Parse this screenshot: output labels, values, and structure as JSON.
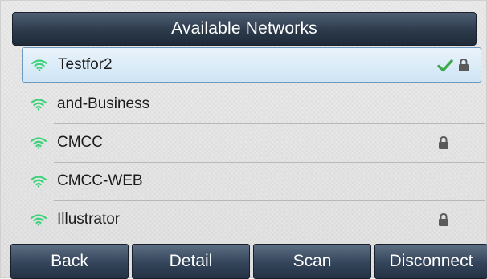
{
  "header": {
    "title": "Available Networks"
  },
  "networks": [
    {
      "name": "Testfor2",
      "connected": true,
      "secured": true,
      "selected": true
    },
    {
      "name": "and-Business",
      "connected": false,
      "secured": false,
      "selected": false
    },
    {
      "name": "CMCC",
      "connected": false,
      "secured": true,
      "selected": false
    },
    {
      "name": "CMCC-WEB",
      "connected": false,
      "secured": false,
      "selected": false
    },
    {
      "name": "Illustrator",
      "connected": false,
      "secured": true,
      "selected": false
    }
  ],
  "softkeys": [
    {
      "label": "Back"
    },
    {
      "label": "Detail"
    },
    {
      "label": "Scan"
    },
    {
      "label": "Disconnect"
    }
  ],
  "colors": {
    "wifi_green": "#3fd27a",
    "check_green": "#3ca94a",
    "lock_gray": "#5a5a5a",
    "title_bar": "#2c3a4b"
  },
  "icons": {
    "signal": "wifi-icon",
    "connected": "check-icon",
    "secured": "lock-icon"
  }
}
